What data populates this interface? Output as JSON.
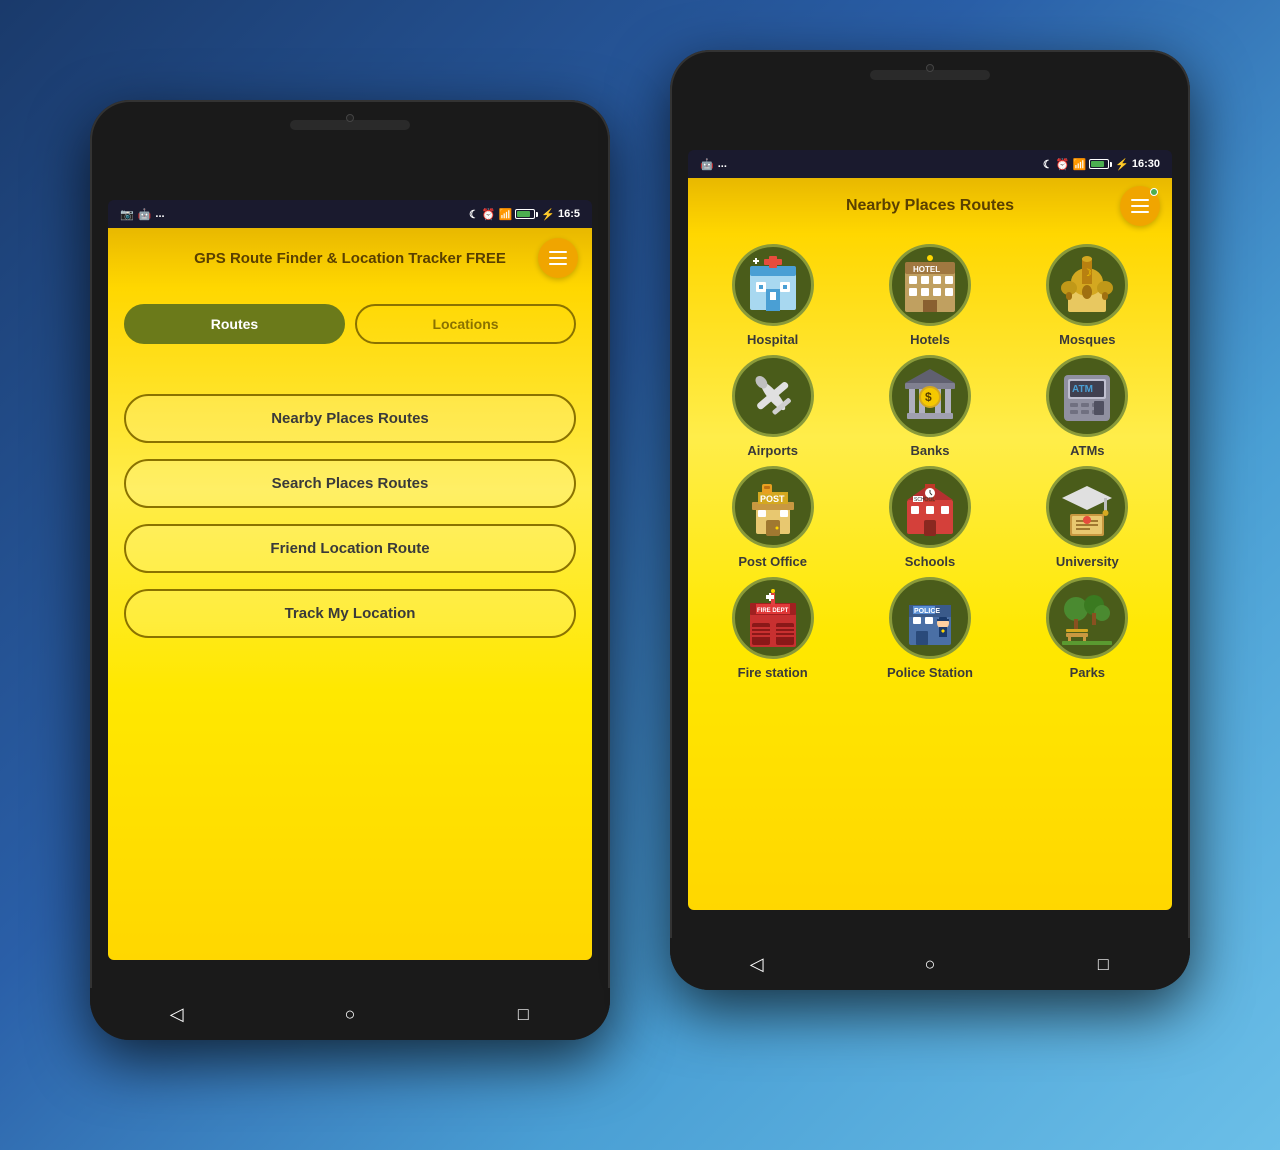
{
  "background": {
    "gradient": "linear-gradient(135deg, #1a3a6b 0%, #2a5fa8 40%, #4a9fd4 70%, #6bbfe8 100%)"
  },
  "phone_left": {
    "status_bar": {
      "left_icons": "📷 🤖 ...",
      "time": "16:5",
      "moon": "☾",
      "clock": "⏰",
      "wifi": "WiFi",
      "battery": "Battery",
      "charging": "⚡"
    },
    "header": {
      "title": "GPS Route Finder & Location Tracker FREE",
      "menu_aria": "Menu"
    },
    "tabs": [
      {
        "label": "Routes",
        "active": true
      },
      {
        "label": "Locations",
        "active": false
      }
    ],
    "menu_items": [
      "Nearby Places Routes",
      "Search Places Routes",
      "Friend Location Route",
      "Track My Location"
    ],
    "bottom_nav": [
      "◁",
      "○",
      "□"
    ]
  },
  "phone_right": {
    "status_bar": {
      "left_icons": "🤖 ...",
      "time": "16:30",
      "moon": "☾",
      "clock": "⏰",
      "wifi": "WiFi",
      "battery": "Battery",
      "charging": "⚡"
    },
    "header": {
      "title": "Nearby Places Routes",
      "menu_aria": "Menu"
    },
    "places": [
      {
        "label": "Hospital",
        "icon": "hospital",
        "color": "#3d5a1a"
      },
      {
        "label": "Hotels",
        "icon": "hotel",
        "color": "#3d5a1a"
      },
      {
        "label": "Mosques",
        "icon": "mosque",
        "color": "#3d5a1a"
      },
      {
        "label": "Airports",
        "icon": "airport",
        "color": "#3d5a1a"
      },
      {
        "label": "Banks",
        "icon": "bank",
        "color": "#3d5a1a"
      },
      {
        "label": "ATMs",
        "icon": "atm",
        "color": "#3d5a1a"
      },
      {
        "label": "Post Office",
        "icon": "post",
        "color": "#3d5a1a"
      },
      {
        "label": "Schools",
        "icon": "school",
        "color": "#3d5a1a"
      },
      {
        "label": "University",
        "icon": "university",
        "color": "#3d5a1a"
      },
      {
        "label": "Fire station",
        "icon": "fire",
        "color": "#3d5a1a"
      },
      {
        "label": "Police Station",
        "icon": "police",
        "color": "#3d5a1a"
      },
      {
        "label": "Parks",
        "icon": "park",
        "color": "#3d5a1a"
      }
    ],
    "bottom_nav": [
      "◁",
      "○",
      "□"
    ]
  }
}
